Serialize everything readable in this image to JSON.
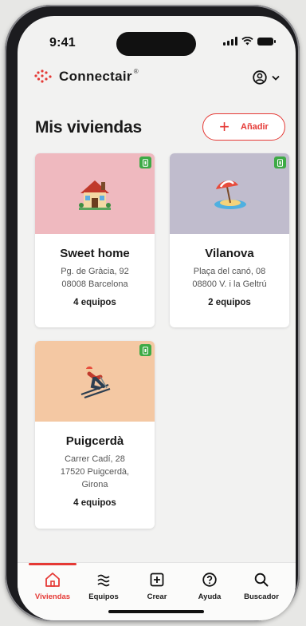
{
  "status": {
    "time": "9:41"
  },
  "header": {
    "brand": "Connectair",
    "brand_mark": "®"
  },
  "page": {
    "title": "Mis viviendas",
    "add_label": "Añadir"
  },
  "homes": [
    {
      "name": "Sweet home",
      "address_line1": "Pg. de Gràcia, 92",
      "address_line2": "08008 Barcelona",
      "address_line3": "",
      "devices": "4 equipos",
      "image_icon": "house-icon",
      "bg": "#efb9bf"
    },
    {
      "name": "Vilanova",
      "address_line1": "Plaça del canó, 08",
      "address_line2": "08800 V. i la Geltrú",
      "address_line3": "",
      "devices": "2 equipos",
      "image_icon": "beach-umbrella-icon",
      "bg": "#c0bccd"
    },
    {
      "name": "Puigcerdà",
      "address_line1": "Carrer Cadí, 28",
      "address_line2": "17520 Puigcerdà,",
      "address_line3": "Girona",
      "devices": "4 equipos",
      "image_icon": "skier-icon",
      "bg": "#f4c8a3"
    }
  ],
  "nav": {
    "items": [
      {
        "label": "Viviendas",
        "icon": "home-icon",
        "active": true
      },
      {
        "label": "Equipos",
        "icon": "waves-icon",
        "active": false
      },
      {
        "label": "Crear",
        "icon": "plus-square-icon",
        "active": false
      },
      {
        "label": "Ayuda",
        "icon": "help-icon",
        "active": false
      },
      {
        "label": "Buscador",
        "icon": "search-icon",
        "active": false
      }
    ]
  },
  "colors": {
    "accent": "#e53935",
    "badge": "#3daa45"
  }
}
